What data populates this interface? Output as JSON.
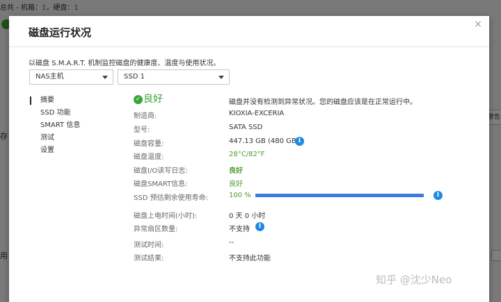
{
  "background": {
    "summary_prefix": "总共 - 机箱：",
    "summary_chassis": "1",
    "summary_mid": "，硬盘：",
    "summary_disks": "1",
    "side_text_a": "存",
    "side_text_b": "用",
    "right_box_text": "警告"
  },
  "dialog": {
    "title": "磁盘运行状况",
    "close_glyph": "×",
    "description": "以磁盘 S.M.A.R.T. 机制监控磁盘的健康度、温度与使用状况。"
  },
  "selects": {
    "host": "NAS主机",
    "disk": "SSD 1"
  },
  "nav": {
    "items": [
      "摘要",
      "SSD 功能",
      "SMART 信息",
      "测试",
      "设置"
    ],
    "active_index": 0
  },
  "status": {
    "label": "良好",
    "check_glyph": "✓",
    "description": "磁盘并没有检测到异常状况。您的磁盘应该是在正常运行中。",
    "color": "#3aa53a"
  },
  "details": {
    "manufacturer_label": "制造商:",
    "manufacturer": "KIOXIA-EXCERIA",
    "model_label": "型号:",
    "model": "SATA SSD",
    "capacity_label": "磁盘容量:",
    "capacity": "447.13 GB (480 GB)",
    "temperature_label": "磁盘温度:",
    "temperature": "28°C/82°F",
    "io_log_label": "磁盘I/O读写日志:",
    "io_log": "良好",
    "smart_label": "磁盘SMART信息:",
    "smart": "良好",
    "life_label": "SSD 预估剩余使用寿命:",
    "life": "100 %",
    "life_percent": 100,
    "power_on_label": "磁盘上电时间(小时):",
    "power_on": "0 天 0 小时",
    "bad_sectors_label": "异常扇区数量:",
    "bad_sectors": "不支持",
    "test_time_label": "测试时间:",
    "test_time": "--",
    "test_result_label": "测试结果:",
    "test_result": "不支持此功能"
  },
  "icons": {
    "info_glyph": "i"
  },
  "watermark": "知乎 @沈少Neo"
}
